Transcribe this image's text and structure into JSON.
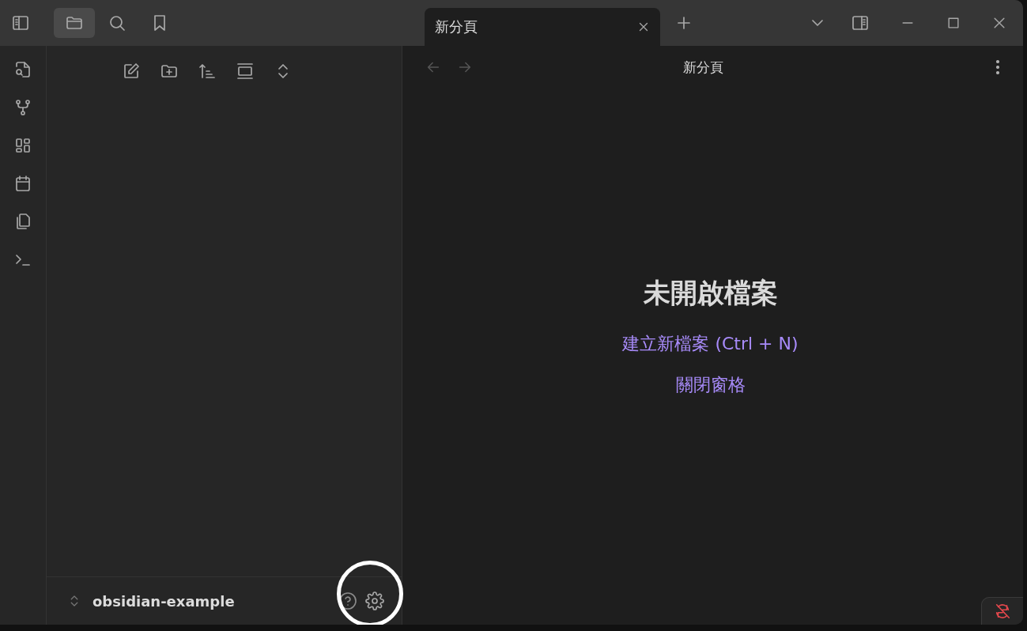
{
  "tabs": [
    {
      "label": "新分頁",
      "selected": true
    }
  ],
  "view_header": {
    "title": "新分頁"
  },
  "empty_state": {
    "title": "未開啟檔案",
    "actions": [
      "建立新檔案 (Ctrl + N)",
      "關閉窗格"
    ]
  },
  "vault": {
    "name": "obsidian-example"
  },
  "sidebar_tabs": [
    {
      "kind": "folder",
      "selected": true
    },
    {
      "kind": "search",
      "selected": false
    },
    {
      "kind": "bookmark",
      "selected": false
    }
  ]
}
